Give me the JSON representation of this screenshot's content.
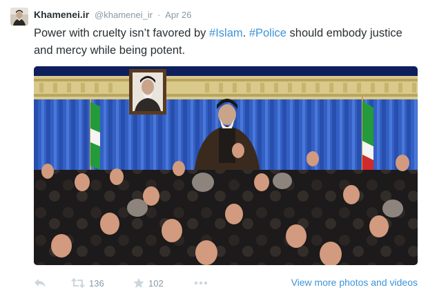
{
  "tweet": {
    "author_name": "Khamenei.ir",
    "author_handle": "@khamenei_ir",
    "separator": "·",
    "date": "Apr 26",
    "text_parts": {
      "p1": "Power with cruelty isn’t favored by ",
      "tag1": "#Islam",
      "p2": ". ",
      "tag2": "#Police",
      "p3": " should embody justice and mercy while being potent."
    }
  },
  "actions": {
    "retweet_count": "136",
    "favorite_count": "102",
    "view_more_label": "View more photos and videos"
  },
  "colors": {
    "link": "#3b94d9",
    "muted": "#8899a6",
    "text": "#292f33"
  },
  "icons": [
    "reply-icon",
    "retweet-icon",
    "star-icon",
    "more-icon"
  ]
}
